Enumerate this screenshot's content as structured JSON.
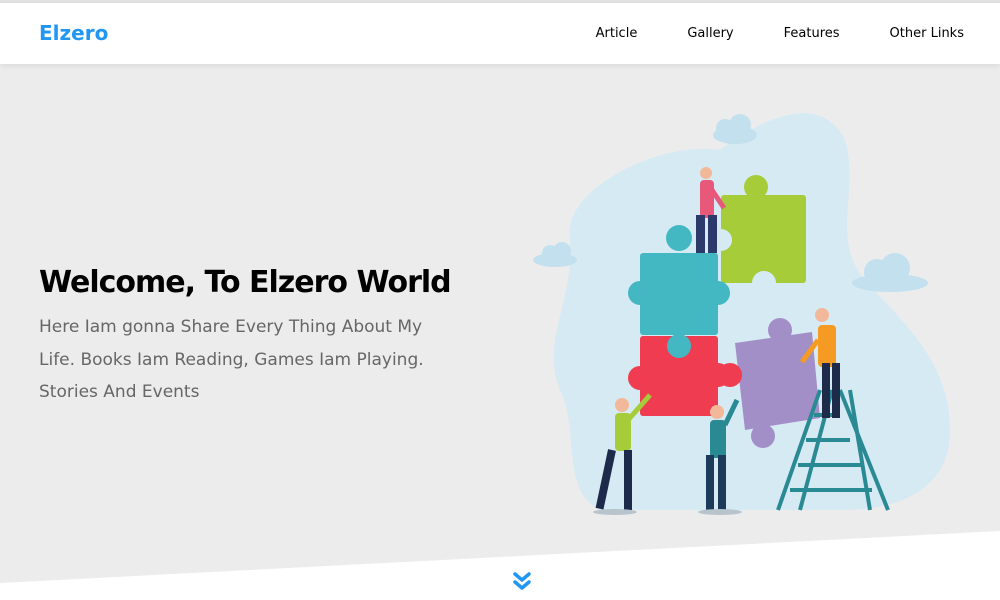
{
  "header": {
    "logo": "Elzero",
    "nav": [
      {
        "label": "Article"
      },
      {
        "label": "Gallery"
      },
      {
        "label": "Features"
      },
      {
        "label": "Other Links"
      }
    ]
  },
  "landing": {
    "title": "Welcome, To Elzero World",
    "description": "Here Iam gonna Share Every Thing About My Life. Books Iam Reading, Games Iam Playing. Stories And Events",
    "illustration": "team-building-puzzle-illustration"
  },
  "go_down_icon": "double-chevron-down-icon",
  "colors": {
    "accent": "#2196f3",
    "landing_bg": "#ececec",
    "text_muted": "#666666"
  }
}
